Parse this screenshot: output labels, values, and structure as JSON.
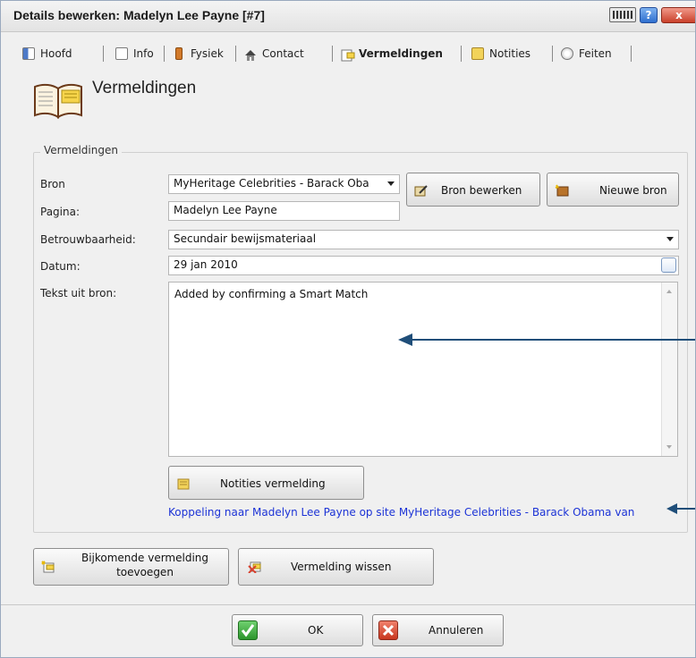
{
  "window": {
    "title": "Details bewerken: Madelyn Lee Payne [#7]",
    "help_label": "?",
    "close_label": "x"
  },
  "tabs": [
    {
      "label": "Hoofd",
      "icon": "hoofd-icon"
    },
    {
      "label": "Info",
      "icon": "info-icon"
    },
    {
      "label": "Fysiek",
      "icon": "fysiek-icon"
    },
    {
      "label": "Contact",
      "icon": "house-icon"
    },
    {
      "label": "Vermeldingen",
      "icon": "citation-icon",
      "active": true
    },
    {
      "label": "Notities",
      "icon": "notes-icon"
    },
    {
      "label": "Feiten",
      "icon": "facts-icon"
    }
  ],
  "page": {
    "title": "Vermeldingen"
  },
  "group": {
    "legend": "Vermeldingen"
  },
  "form": {
    "bron_label": "Bron",
    "bron_value": "MyHeritage Celebrities - Barack Oba",
    "pagina_label": "Pagina:",
    "pagina_value": "Madelyn Lee Payne",
    "betrouwbaarheid_label": "Betrouwbaarheid:",
    "betrouwbaarheid_value": "Secundair bewijsmateriaal",
    "datum_label": "Datum:",
    "datum_value": "29 jan 2010",
    "tekst_label": "Tekst uit bron:",
    "tekst_value": "Added by confirming a Smart Match"
  },
  "buttons": {
    "bron_bewerken": "Bron bewerken",
    "nieuwe_bron": "Nieuwe bron",
    "notities_vermelding": "Notities vermelding",
    "bijkomende_line1": "Bijkomende vermelding",
    "bijkomende_line2": "toevoegen",
    "vermelding_wissen": "Vermelding wissen",
    "ok": "OK",
    "annuleren": "Annuleren"
  },
  "link": {
    "text": "Koppeling naar Madelyn Lee Payne op site MyHeritage Celebrities - Barack Obama van"
  },
  "colors": {
    "link": "#1c33d6",
    "arrow": "#1f4e79",
    "ok_green": "#3aa63a",
    "cancel_red": "#d9412e"
  }
}
